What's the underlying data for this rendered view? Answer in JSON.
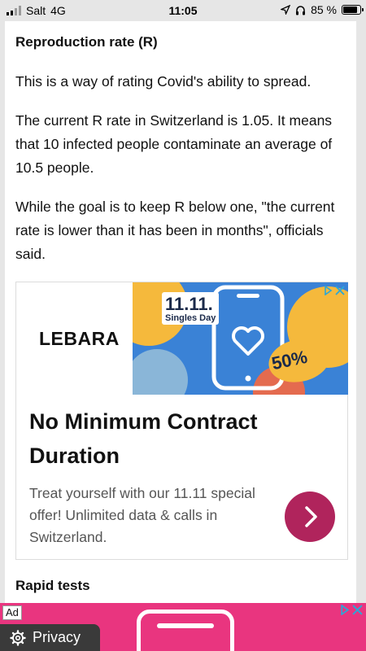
{
  "statusbar": {
    "carrier": "Salt",
    "network": "4G",
    "time": "11:05",
    "battery": "85 %",
    "battery_level": 0.85
  },
  "article": {
    "section_title": "Reproduction rate (R)",
    "paragraphs": [
      "This is a way of rating Covid's ability to spread.",
      "The current R rate in Switzerland is 1.05. It means that 10 infected people contaminate an average of 10.5 people.",
      "While the goal is to keep R below one, \"the current rate is lower than it has been in months\", officials said."
    ],
    "next_section_title": "Rapid tests"
  },
  "ad": {
    "brand": "LEBARA",
    "image_date": "11.11.",
    "image_event": "Singles Day",
    "image_discount": "50%",
    "headline": "No Minimum Contract Duration",
    "body": "Treat yourself with our 11.11 special offer! Unlimited data & calls in Switzerland.",
    "cta_icon": "chevron-right-icon",
    "cta_color": "#b0245c"
  },
  "banner": {
    "ad_label": "Ad",
    "background": "#e9357f"
  },
  "privacy": {
    "label": "Privacy",
    "icon": "gear-icon"
  }
}
